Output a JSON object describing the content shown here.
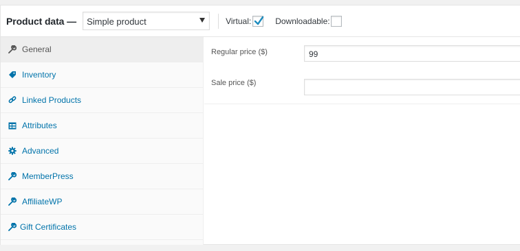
{
  "header": {
    "title": "Product data —",
    "product_type": "Simple product",
    "virtual_label": "Virtual:",
    "virtual_checked": true,
    "downloadable_label": "Downloadable:",
    "downloadable_checked": false
  },
  "sidebar": {
    "items": [
      {
        "label": "General",
        "icon": "wrench-icon",
        "active": true
      },
      {
        "label": "Inventory",
        "icon": "tag-icon",
        "active": false
      },
      {
        "label": "Linked Products",
        "icon": "link-icon",
        "active": false
      },
      {
        "label": "Attributes",
        "icon": "table-icon",
        "active": false
      },
      {
        "label": "Advanced",
        "icon": "gear-icon",
        "active": false
      },
      {
        "label": "MemberPress",
        "icon": "wrench-icon",
        "active": false
      },
      {
        "label": "AffiliateWP",
        "icon": "wrench-icon",
        "active": false
      },
      {
        "label": "Gift Certificates",
        "icon": "wrench-icon",
        "active": false
      }
    ]
  },
  "general": {
    "regular_price_label": "Regular price ($)",
    "regular_price_value": "99",
    "sale_price_label": "Sale price ($)",
    "sale_price_value": ""
  },
  "colors": {
    "link": "#0073aa",
    "check": "#1e8cbe"
  }
}
